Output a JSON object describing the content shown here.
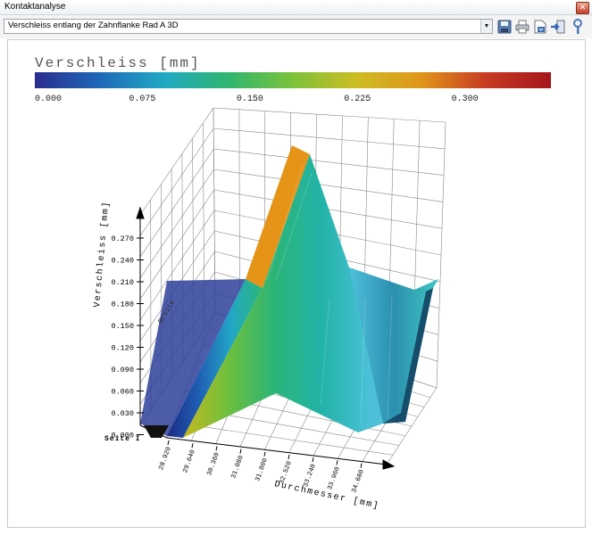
{
  "window": {
    "title": "Kontaktanalyse",
    "close_glyph": "✕"
  },
  "toolbar": {
    "dropdown_value": "Verschleiss entlang der Zahnflanke Rad A 3D",
    "dropdown_arrow": "▼",
    "icons": [
      "save-icon",
      "print-icon",
      "export-icon",
      "import-icon",
      "settings-icon"
    ]
  },
  "legend": {
    "title": "Verschleiss [mm]",
    "ticks": [
      "0.000",
      "0.075",
      "0.150",
      "0.225",
      "0.300"
    ],
    "range": [
      0,
      0.36
    ],
    "colors": [
      "#2a2d8e",
      "#1f68b8",
      "#21a9c4",
      "#2fb56f",
      "#7cc23a",
      "#cdbd22",
      "#e0941b",
      "#c73a23",
      "#a4151a"
    ]
  },
  "plot": {
    "zlabel": "Verschleiss [mm]",
    "z_ticks": [
      "0.270",
      "0.240",
      "0.210",
      "0.180",
      "0.150",
      "0.120",
      "0.090",
      "0.060",
      "0.030",
      "0.000"
    ],
    "xlabel": "Durchmesser [mm]",
    "x_ticks": [
      "28.920",
      "29.640",
      "30.360",
      "31.080",
      "31.800",
      "32.520",
      "33.240",
      "33.960",
      "34.680"
    ],
    "ylabel": "Breite",
    "side_label": "Seite I"
  }
}
